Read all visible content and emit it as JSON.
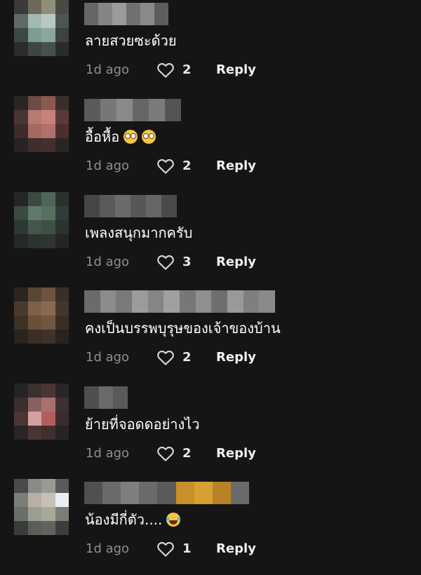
{
  "comments": [
    {
      "text": "ลายสวยซะด้วย",
      "emojis": [],
      "time": "1d ago",
      "likes": "2",
      "reply_label": "Reply",
      "avatar_pixels": [
        "#3a3a3a",
        "#6d6a5c",
        "#8f8f7a",
        "#4a4a44",
        "#5f6a68",
        "#a3b8b3",
        "#b9c9c2",
        "#4c5552",
        "#3d4743",
        "#7c9d94",
        "#8aa69d",
        "#3b423f",
        "#2a2d2c",
        "#3c4642",
        "#46514d",
        "#2a2c2b"
      ],
      "username_pixels": [
        "#666666",
        "#858585",
        "#9a9a9a",
        "#707070",
        "#8a8a8a",
        "#5d5d5d"
      ]
    },
    {
      "text": "อื้อหื้อ",
      "emojis": [
        "flushed",
        "flushed"
      ],
      "time": "1d ago",
      "likes": "2",
      "reply_label": "Reply",
      "avatar_pixels": [
        "#2b2626",
        "#6d4a45",
        "#8a5a52",
        "#3a2e2c",
        "#4a3431",
        "#b77a72",
        "#c8807a",
        "#5a3a37",
        "#3e2c2a",
        "#a26a63",
        "#b0716b",
        "#4a302d",
        "#2a2323",
        "#3e2d2b",
        "#43302e",
        "#2b2424"
      ],
      "username_pixels": [
        "#5a5a5a",
        "#777777",
        "#8a8a8a",
        "#666666",
        "#7b7b7b",
        "#545454"
      ]
    },
    {
      "text": "เพลงสนุกมากครับ",
      "emojis": [],
      "time": "1d ago",
      "likes": "3",
      "reply_label": "Reply",
      "avatar_pixels": [
        "#242724",
        "#3d4a44",
        "#4f6558",
        "#2a302c",
        "#3a4a42",
        "#5d7a6c",
        "#56705f",
        "#323c37",
        "#2e3833",
        "#44574c",
        "#3f4f46",
        "#2b332f",
        "#242826",
        "#2c332f",
        "#2e3531",
        "#232624"
      ],
      "username_pixels": [
        "#464646",
        "#5a5a5a",
        "#6b6b6b",
        "#575757",
        "#666666",
        "#4a4a4a"
      ]
    },
    {
      "text": "คงเป็นบรรพบุรุษของเจ้าของบ้าน",
      "emojis": [],
      "time": "1d ago",
      "likes": "2",
      "reply_label": "Reply",
      "avatar_pixels": [
        "#2b2520",
        "#5a4634",
        "#6d5440",
        "#3a2f26",
        "#4a3a2c",
        "#7d6248",
        "#8a6a4d",
        "#45362a",
        "#3e3126",
        "#6a5039",
        "#715640",
        "#3a2e24",
        "#2a231e",
        "#3b2f25",
        "#3f3228",
        "#29221d"
      ],
      "username_pixels": [
        "#6b6b6b",
        "#8c8c8c",
        "#7a7a7a",
        "#9b9b9b",
        "#858585",
        "#a0a0a0",
        "#777777",
        "#8f8f8f",
        "#6e6e6e",
        "#999999",
        "#7f7f7f",
        "#8a8a8a"
      ]
    },
    {
      "text": "ย้ายที่จอดดอย่างไว",
      "emojis": [],
      "time": "1d ago",
      "likes": "2",
      "reply_label": "Reply",
      "avatar_pixels": [
        "#252323",
        "#3a3030",
        "#4a3434",
        "#2a2626",
        "#3a2e2e",
        "#8a6060",
        "#a87070",
        "#3e3030",
        "#4a3636",
        "#d4a0a0",
        "#b25e5e",
        "#3a2c2c",
        "#2a2424",
        "#4a3434",
        "#3e2e2e",
        "#272323"
      ],
      "username_pixels": [
        "#4e4e4e",
        "#6a6a6a",
        "#5a5a5a"
      ]
    },
    {
      "text": "น้องมีกี่ตัว....",
      "emojis": [
        "joy"
      ],
      "time": "1d ago",
      "likes": "1",
      "reply_label": "Reply",
      "avatar_pixels": [
        "#4a4a4a",
        "#8a8a86",
        "#9a9a94",
        "#5a5a58",
        "#7a8078",
        "#b8b0a4",
        "#c8c0b4",
        "#e8eef2",
        "#6a7068",
        "#9aa090",
        "#a8a89a",
        "#7a7e74",
        "#3a3c3a",
        "#5a5e58",
        "#60645c",
        "#3c3e3c"
      ],
      "username_pixels": [
        "#505050",
        "#6a6a6a",
        "#7e7e7e",
        "#6a6a6a",
        "#5a5a5a",
        "#c8902a",
        "#d8a030",
        "#b88226",
        "#6a6a6a"
      ]
    }
  ],
  "colors": {
    "background": "#151515",
    "text": "#ffffff",
    "meta": "#8f8f8f"
  },
  "icons": {
    "like": "heart-icon"
  }
}
